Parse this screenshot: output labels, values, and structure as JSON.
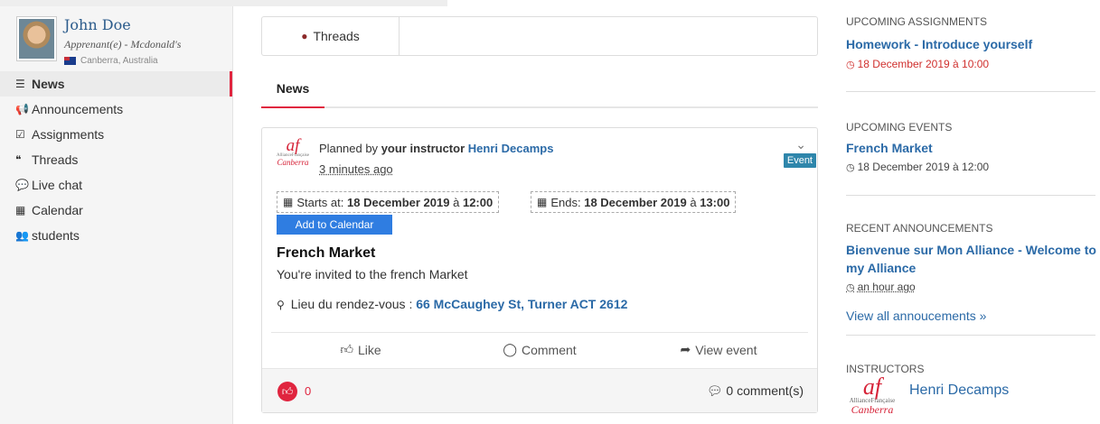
{
  "profile": {
    "name": "John Doe",
    "role": "Apprenant(e) - Mcdonald's",
    "location": "Canberra, Australia"
  },
  "nav": [
    {
      "label": "News",
      "icon": "list-icon",
      "glyph": "☰",
      "active": true
    },
    {
      "label": "Announcements",
      "icon": "bullhorn-icon",
      "glyph": "📢"
    },
    {
      "label": "Assignments",
      "icon": "checkbox-icon",
      "glyph": "☑"
    },
    {
      "label": "Threads",
      "icon": "quote-icon",
      "glyph": "❝"
    },
    {
      "label": "Live chat",
      "icon": "chat-bubble-icon",
      "glyph": "💬"
    },
    {
      "label": "Calendar",
      "icon": "calendar-icon",
      "glyph": "▦"
    },
    {
      "label": "students",
      "icon": "users-icon",
      "glyph": "👥"
    }
  ],
  "tabs": {
    "threads_label": "Threads",
    "news_label": "News"
  },
  "post": {
    "planned_prefix": "Planned by",
    "planned_by_bold": "your instructor",
    "instructor": "Henri Decamps",
    "time_ago": "3 minutes ago",
    "badge": "Event",
    "starts_label": "Starts at:",
    "starts_date": "18 December 2019",
    "starts_sep": "à",
    "starts_time": "12:00",
    "ends_label": "Ends:",
    "ends_date": "18 December 2019",
    "ends_sep": "à",
    "ends_time": "13:00",
    "add_to_calendar": "Add to Calendar",
    "title": "French Market",
    "description": "You're invited to the french Market",
    "location_label": "Lieu du rendez-vous :",
    "location_address": "66 McCaughey St, Turner ACT 2612",
    "actions": {
      "like": "Like",
      "comment": "Comment",
      "view": "View event"
    },
    "like_count": "0",
    "comment_count": "0 comment(s)"
  },
  "logo": {
    "mark": "af",
    "line": "AllianceFrançaise",
    "city": "Canberra"
  },
  "right": {
    "assignments": {
      "title": "UPCOMING ASSIGNMENTS",
      "item": "Homework - Introduce yourself",
      "date": "18 December 2019 à 10:00"
    },
    "events": {
      "title": "UPCOMING EVENTS",
      "item": "French Market",
      "date": "18 December 2019 à 12:00"
    },
    "announcements": {
      "title": "RECENT ANNOUNCEMENTS",
      "item": "Bienvenue sur Mon Alliance - Welcome to my Alliance",
      "time": "an hour ago",
      "view_all": "View all annoucements »"
    },
    "instructors": {
      "title": "INSTRUCTORS",
      "name": "Henri Decamps"
    }
  },
  "colors": {
    "accent_red": "#e0253f",
    "link_blue": "#2b6aa7",
    "button_blue": "#2f7de1",
    "badge_blue": "#2e86ab"
  }
}
